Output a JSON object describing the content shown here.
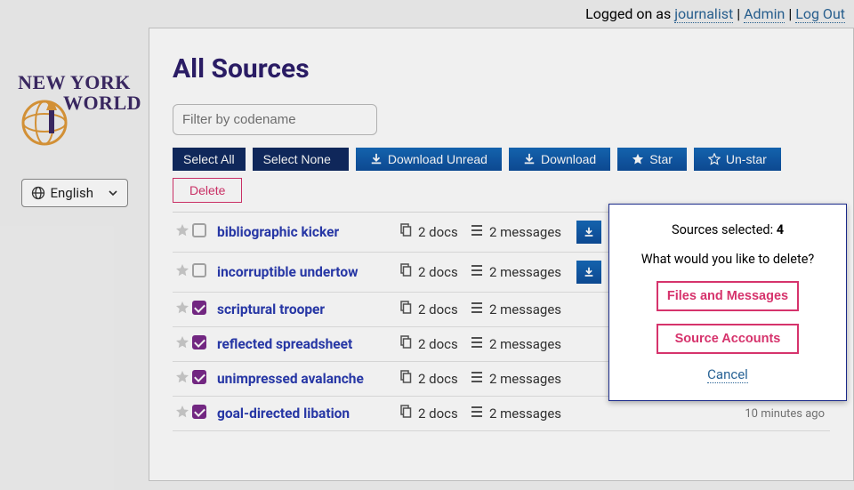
{
  "topbar": {
    "logged_on_prefix": "Logged on as ",
    "username": "journalist",
    "admin_link": "Admin",
    "logout_link": "Log Out"
  },
  "logo": {
    "line1": "NEW YORK",
    "line2": "WORLD"
  },
  "language_selector": {
    "label": "English"
  },
  "page": {
    "title": "All Sources",
    "filter_placeholder": "Filter by codename"
  },
  "toolbar": {
    "select_all": "Select All",
    "select_none": "Select None",
    "download_unread": "Download Unread",
    "download": "Download",
    "star": "Star",
    "unstar": "Un-star",
    "delete": "Delete"
  },
  "rows": [
    {
      "codename": "bibliographic kicker",
      "checked": false,
      "docs": "2 docs",
      "messages": "2 messages",
      "show_dl": true,
      "time": ""
    },
    {
      "codename": "incorruptible undertow",
      "checked": false,
      "docs": "2 docs",
      "messages": "2 messages",
      "show_dl": true,
      "time": ""
    },
    {
      "codename": "scriptural trooper",
      "checked": true,
      "docs": "2 docs",
      "messages": "2 messages",
      "show_dl": false,
      "time": ""
    },
    {
      "codename": "reflected spreadsheet",
      "checked": true,
      "docs": "2 docs",
      "messages": "2 messages",
      "show_dl": false,
      "time": ""
    },
    {
      "codename": "unimpressed avalanche",
      "checked": true,
      "docs": "2 docs",
      "messages": "2 messages",
      "show_dl": false,
      "time": ""
    },
    {
      "codename": "goal-directed libation",
      "checked": true,
      "docs": "2 docs",
      "messages": "2 messages",
      "show_dl": false,
      "time": "10 minutes ago"
    }
  ],
  "modal": {
    "selected_prefix": "Sources selected: ",
    "selected_count": "4",
    "question": "What would you like to delete?",
    "files_btn": "Files and Messages",
    "accounts_btn": "Source Accounts",
    "cancel": "Cancel"
  }
}
